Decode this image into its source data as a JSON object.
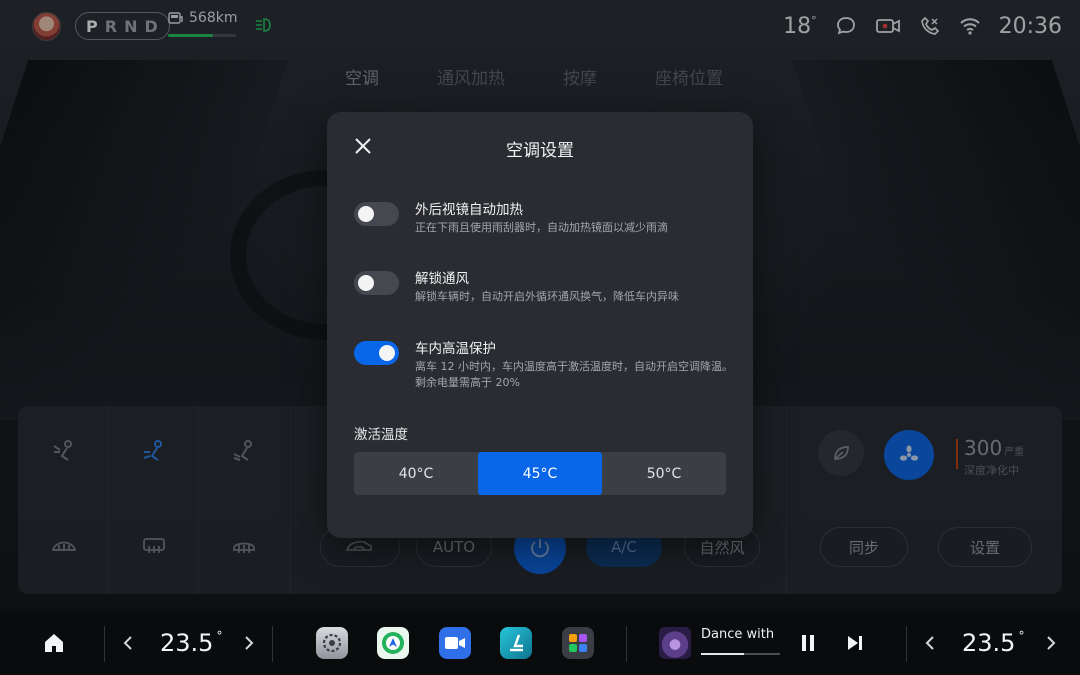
{
  "status": {
    "gear": [
      "P",
      "R",
      "N",
      "D"
    ],
    "active_gear": "P",
    "range": "568km",
    "range_level": 0.66,
    "outside_temp": "18",
    "degree": "°",
    "time": "20:36",
    "icons": [
      "avatar",
      "battery-icon",
      "headlight-icon",
      "chat-icon",
      "dashcam-icon",
      "phone-link-icon",
      "wifi-icon"
    ]
  },
  "tabs": [
    "空调",
    "通风加热",
    "按摩",
    "座椅位置"
  ],
  "panel": {
    "auto_label": "AUTO",
    "ac_label": "A/C",
    "natural_label": "自然风",
    "sync_label": "同步",
    "settings_label": "设置",
    "aqi_value": "300",
    "aqi_unit": "严重",
    "aqi_status": "深度净化中"
  },
  "modal": {
    "title": "空调设置",
    "options": [
      {
        "title": "外后视镜自动加热",
        "desc": "正在下雨且使用雨刮器时，自动加热镜面以减少雨滴",
        "on": false
      },
      {
        "title": "解锁通风",
        "desc": "解锁车辆时，自动开启外循环通风换气，降低车内异味",
        "on": false
      },
      {
        "title": "车内高温保护",
        "desc": "离车 12 小时内，车内温度高于激活温度时，自动开启空调降温。剩余电量需高于 20%",
        "on": true
      }
    ],
    "activation_label": "激活温度",
    "temps": [
      "40°C",
      "45°C",
      "50°C"
    ],
    "selected_temp": "45°C"
  },
  "dock": {
    "left_temp": "23.5",
    "right_temp": "23.5",
    "degree": "°",
    "media_title": "Dance with",
    "media_progress": 0.55,
    "apps": [
      "settings-app-icon",
      "maps-app-icon",
      "video-call-app-icon",
      "seat-app-icon",
      "app-drawer-icon"
    ]
  },
  "colors": {
    "accent": "#0a66e8",
    "green": "#22c55e",
    "modal_bg": "#2a2c31"
  }
}
